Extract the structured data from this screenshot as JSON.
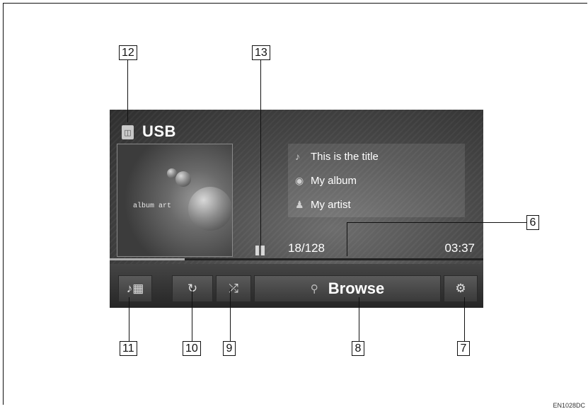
{
  "screen": {
    "source_label": "USB",
    "source_icon": "usb-drive-icon",
    "album_art_label": "album art",
    "track": {
      "title": "This is the title",
      "album": "My album",
      "artist": "My artist",
      "position": "18/128",
      "time": "03:37",
      "progress_fraction": 0.2
    },
    "controls": {
      "browse_label": "Browse",
      "icons": [
        "audio-sound-icon",
        "repeat-icon",
        "shuffle-icon",
        "search-icon",
        "settings-gear-icon"
      ]
    }
  },
  "callouts": {
    "c6": "6",
    "c7": "7",
    "c8": "8",
    "c9": "9",
    "c10": "10",
    "c11": "11",
    "c12": "12",
    "c13": "13"
  },
  "figure_code": "EN1028DC"
}
